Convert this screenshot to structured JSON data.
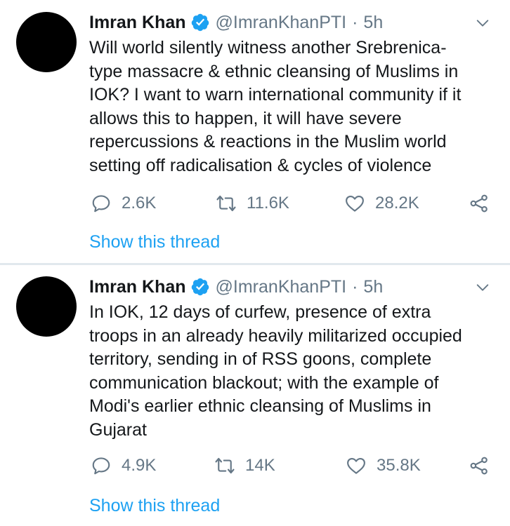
{
  "colors": {
    "text": "#14171a",
    "muted": "#657786",
    "link": "#1da1f2",
    "verified": "#1da1f2",
    "divider": "#e1e8ed",
    "avatar": "#000000"
  },
  "tweets": [
    {
      "author": "Imran Khan",
      "handle": "@ImranKhanPTI",
      "separator": "·",
      "time": "5h",
      "verified": true,
      "text": "Will world silently witness another Srebrenica-\ntype massacre & ethnic cleansing of Muslims in\nIOK? I want to warn international community if it\nallows this to happen, it will have severe\nrepercussions & reactions in the Muslim world\nsetting off radicalisation & cycles of violence",
      "replies": "2.6K",
      "retweets": "11.6K",
      "likes": "28.2K",
      "show_thread": "Show this thread",
      "icons": {
        "reply": "reply-icon",
        "retweet": "retweet-icon",
        "like": "heart-icon",
        "share": "share-icon",
        "menu": "chevron-down-icon",
        "badge": "verified-badge-icon"
      }
    },
    {
      "author": "Imran Khan",
      "handle": "@ImranKhanPTI",
      "separator": "·",
      "time": "5h",
      "verified": true,
      "text": "In IOK, 12 days of curfew, presence of extra\ntroops in an already heavily militarized occupied\nterritory, sending in of RSS goons, complete\ncommunication blackout; with the example of\nModi's earlier ethnic cleansing of Muslims in\nGujarat",
      "replies": "4.9K",
      "retweets": "14K",
      "likes": "35.8K",
      "show_thread": "Show this thread",
      "icons": {
        "reply": "reply-icon",
        "retweet": "retweet-icon",
        "like": "heart-icon",
        "share": "share-icon",
        "menu": "chevron-down-icon",
        "badge": "verified-badge-icon"
      }
    }
  ]
}
